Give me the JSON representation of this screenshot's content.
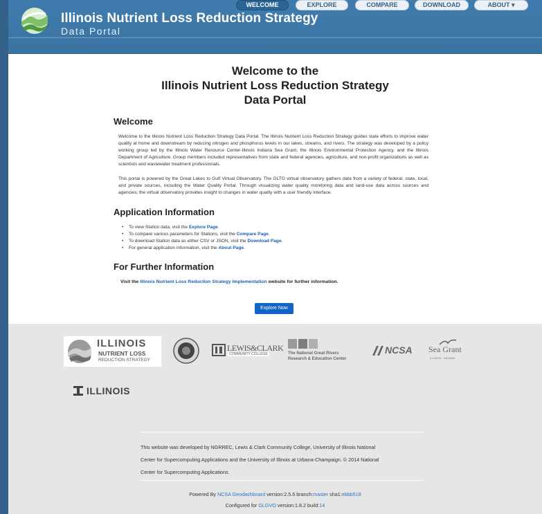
{
  "header": {
    "title": "Illinois Nutrient Loss Reduction Strategy",
    "subtitle": "Data Portal",
    "nav": [
      {
        "label": "WELCOME",
        "active": true
      },
      {
        "label": "EXPLORE",
        "active": false
      },
      {
        "label": "COMPARE",
        "active": false
      },
      {
        "label": "DOWNLOAD",
        "active": false
      },
      {
        "label": "ABOUT ▾",
        "active": false
      }
    ]
  },
  "main": {
    "heading_line1": "Welcome to the",
    "heading_line2": "Illinois Nutrient Loss Reduction Strategy",
    "heading_line3": "Data Portal",
    "welcome": {
      "title": "Welcome",
      "para1": "Welcome to the Illinois Nutrient Loss Reduction Strategy Data Portal. The Illinois Nutrient Loss Reduction Strategy guides state efforts to improve water quality at home and downstream by reducing nitrogen and phosphorus levels in our lakes, streams, and rivers. The strategy was developed by a policy working group led by the Illinois Water Resource Center-Illinois Indiana Sea Grant, the Illinois Environmental Protection Agency, and the Illinois Department of Agriculture. Group members included representatives from state and federal agencies, agriculture, and non-profit organizations as well as scientists and wastewater treatment professionals.",
      "para2": "This portal is powered by the Great Lakes to Gulf Virtual Observatory. The GLTG virtual observatory gathers data from a variety of federal, state, local, and private sources, including the Water Quality Portal. Through visualizing water quality monitoring data and land-use data across sources and agencies, the virtual observatory provides insight to changes in water quality with a user friendly interface."
    },
    "app_info": {
      "title": "Application Information",
      "items": [
        {
          "text": "To view Station data, visit the ",
          "link": "Explore Page",
          "end": "."
        },
        {
          "text": "To compare various parameters for Stations, visit the ",
          "link": "Compare Page",
          "end": "."
        },
        {
          "text": "To download Station data as either CSV or JSON, visit the ",
          "link": "Download Page",
          "end": "."
        },
        {
          "text": "For general application information, visit the ",
          "link": "About Page",
          "end": "."
        }
      ]
    },
    "further": {
      "title": "For Further Information",
      "prefix": "Visit the ",
      "link": "Illinois Nutrient Loss Reduction Strategy Implementation",
      "suffix": " website for further information."
    },
    "explore_button": "Explore Now"
  },
  "footer": {
    "logos": {
      "illinois_big": "ILLINOIS",
      "nutrient_loss": "NUTRIENT LOSS",
      "reduction": "REDUCTION STRATEGY",
      "lewis_clark": "LEWIS&CLARK",
      "lewis_clark_sub": "COMMUNITY COLLEGE",
      "ngrrec_1": "The National Great Rivers",
      "ngrrec_2": "Research & Education Center",
      "ncsa": "NCSA",
      "seagrant": "Sea Grant",
      "seagrant_sub": "ILLINOIS · INDIANA",
      "uiuc": "ILLINOIS"
    },
    "credit_line1": "This website was developed by NGRREC, Lewis & Clark Community College, University of Illinois National",
    "credit_line2": "Center for Supercomputing Applications and the University of Illinois at Urbana-Champaign. © 2014 National",
    "credit_line3": "Center for Supercomputing Applications.",
    "powered_prefix": "Powered By ",
    "powered_link": "NCSA Geodashboard",
    "powered_version": " version:2.5.6 branch:",
    "powered_branch": "master",
    "powered_sha_label": " sha1:",
    "powered_sha": "ebbb518",
    "configured_prefix": "Configured for ",
    "configured_link": "GLGVO",
    "configured_version": " version:1.8.2 build:",
    "configured_build": "14"
  }
}
